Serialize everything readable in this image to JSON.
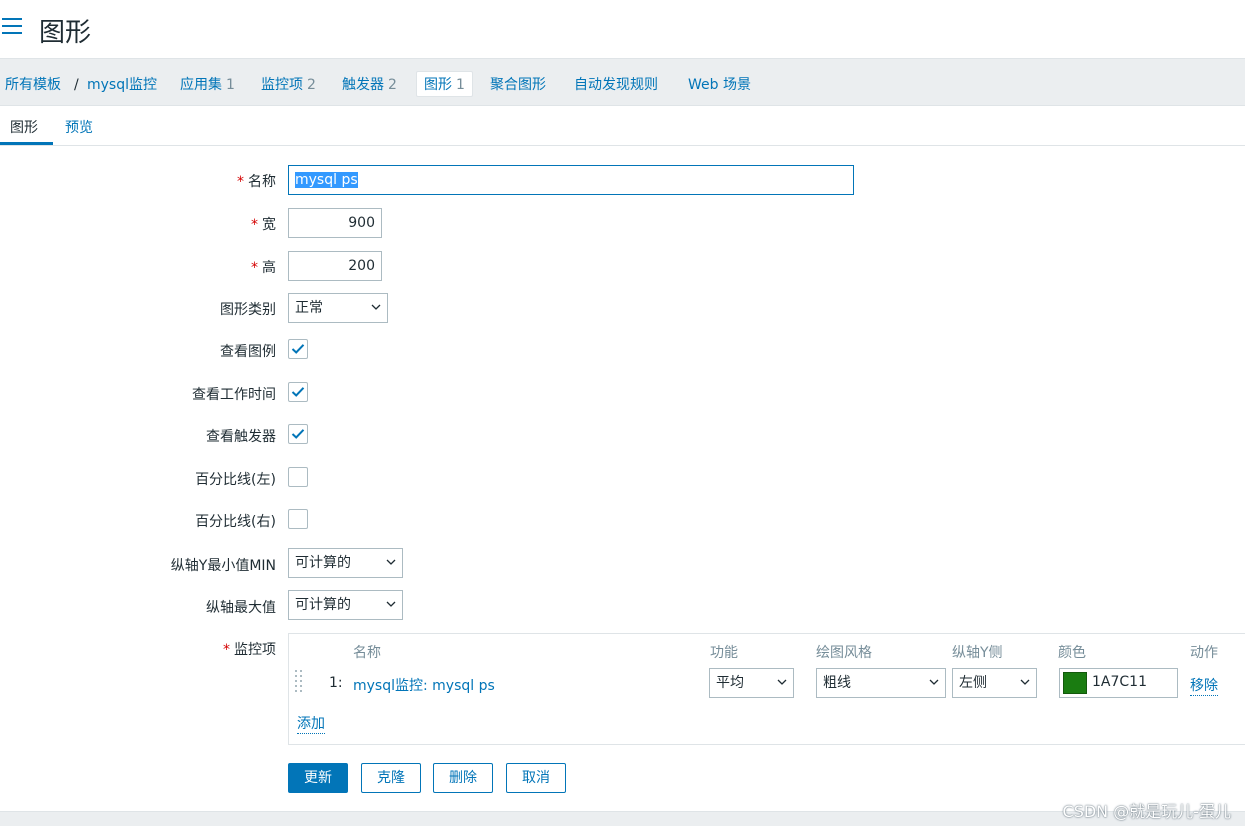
{
  "page": {
    "title": "图形"
  },
  "nav": {
    "all_templates": "所有模板",
    "sep": "/",
    "template_name": "mysql监控",
    "items": [
      {
        "label": "应用集",
        "count": "1"
      },
      {
        "label": "监控项",
        "count": "2"
      },
      {
        "label": "触发器",
        "count": "2"
      },
      {
        "label": "图形",
        "count": "1"
      },
      {
        "label": "聚合图形",
        "count": ""
      },
      {
        "label": "自动发现规则",
        "count": ""
      },
      {
        "label": "Web 场景",
        "count": ""
      }
    ]
  },
  "tabs": {
    "graph": "图形",
    "preview": "预览"
  },
  "form": {
    "required_mark": "*",
    "name_label": "名称",
    "name_value": "mysql ps",
    "width_label": "宽",
    "width_value": "900",
    "height_label": "高",
    "height_value": "200",
    "graph_type_label": "图形类别",
    "graph_type_value": "正常",
    "show_legend_label": "查看图例",
    "show_legend": true,
    "show_worktime_label": "查看工作时间",
    "show_worktime": true,
    "show_triggers_label": "查看触发器",
    "show_triggers": true,
    "percentile_left_label": "百分比线(左)",
    "percentile_left": false,
    "percentile_right_label": "百分比线(右)",
    "percentile_right": false,
    "ymin_label": "纵轴Y最小值MIN",
    "ymin_value": "可计算的",
    "ymax_label": "纵轴最大值",
    "ymax_value": "可计算的",
    "items_label": "监控项"
  },
  "items_table": {
    "headers": {
      "name": "名称",
      "function": "功能",
      "draw_style": "绘图风格",
      "y_side": "纵轴Y侧",
      "color": "颜色",
      "action": "动作"
    },
    "rows": [
      {
        "index": "1:",
        "name": "mysql监控: mysql ps",
        "function": "平均",
        "draw_style": "粗线",
        "y_side": "左侧",
        "color": "1A7C11",
        "action": "移除"
      }
    ],
    "add_label": "添加"
  },
  "buttons": {
    "update": "更新",
    "clone": "克隆",
    "delete": "删除",
    "cancel": "取消"
  },
  "watermark": "CSDN @就是玩儿-蛋儿",
  "colors": {
    "accent": "#0275b8",
    "swatch": "#1a7c11",
    "required": "#d40000"
  }
}
